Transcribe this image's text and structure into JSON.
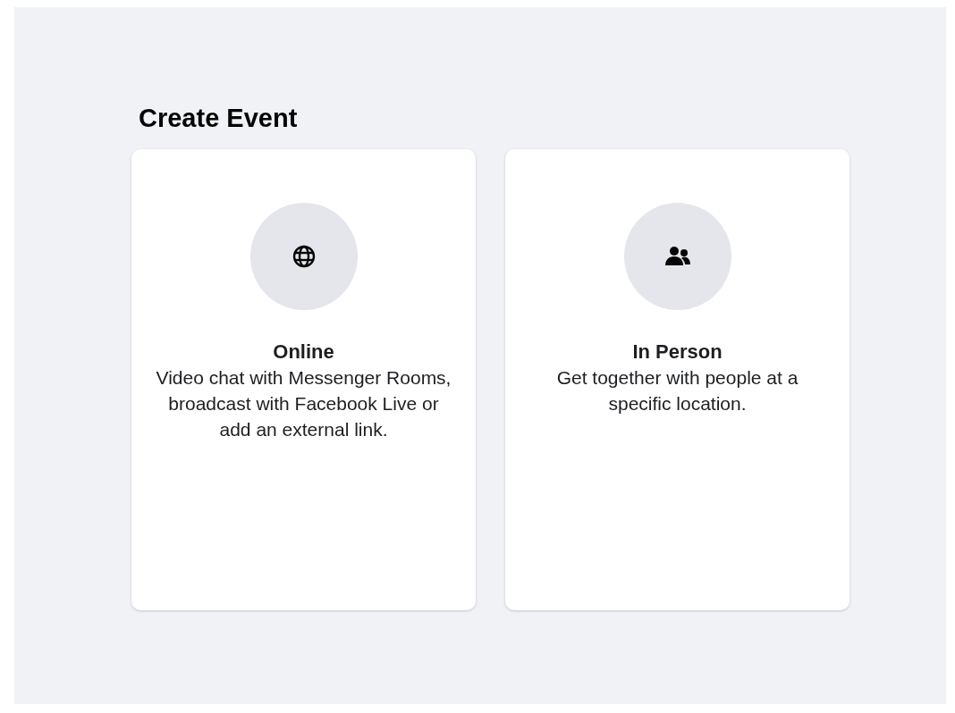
{
  "title": "Create Event",
  "options": [
    {
      "kind": "globe",
      "title": "Online",
      "description": "Video chat with Messenger Rooms, broadcast with Facebook Live or add an external link."
    },
    {
      "kind": "people",
      "title": "In Person",
      "description": "Get together with people at a specific location."
    }
  ]
}
